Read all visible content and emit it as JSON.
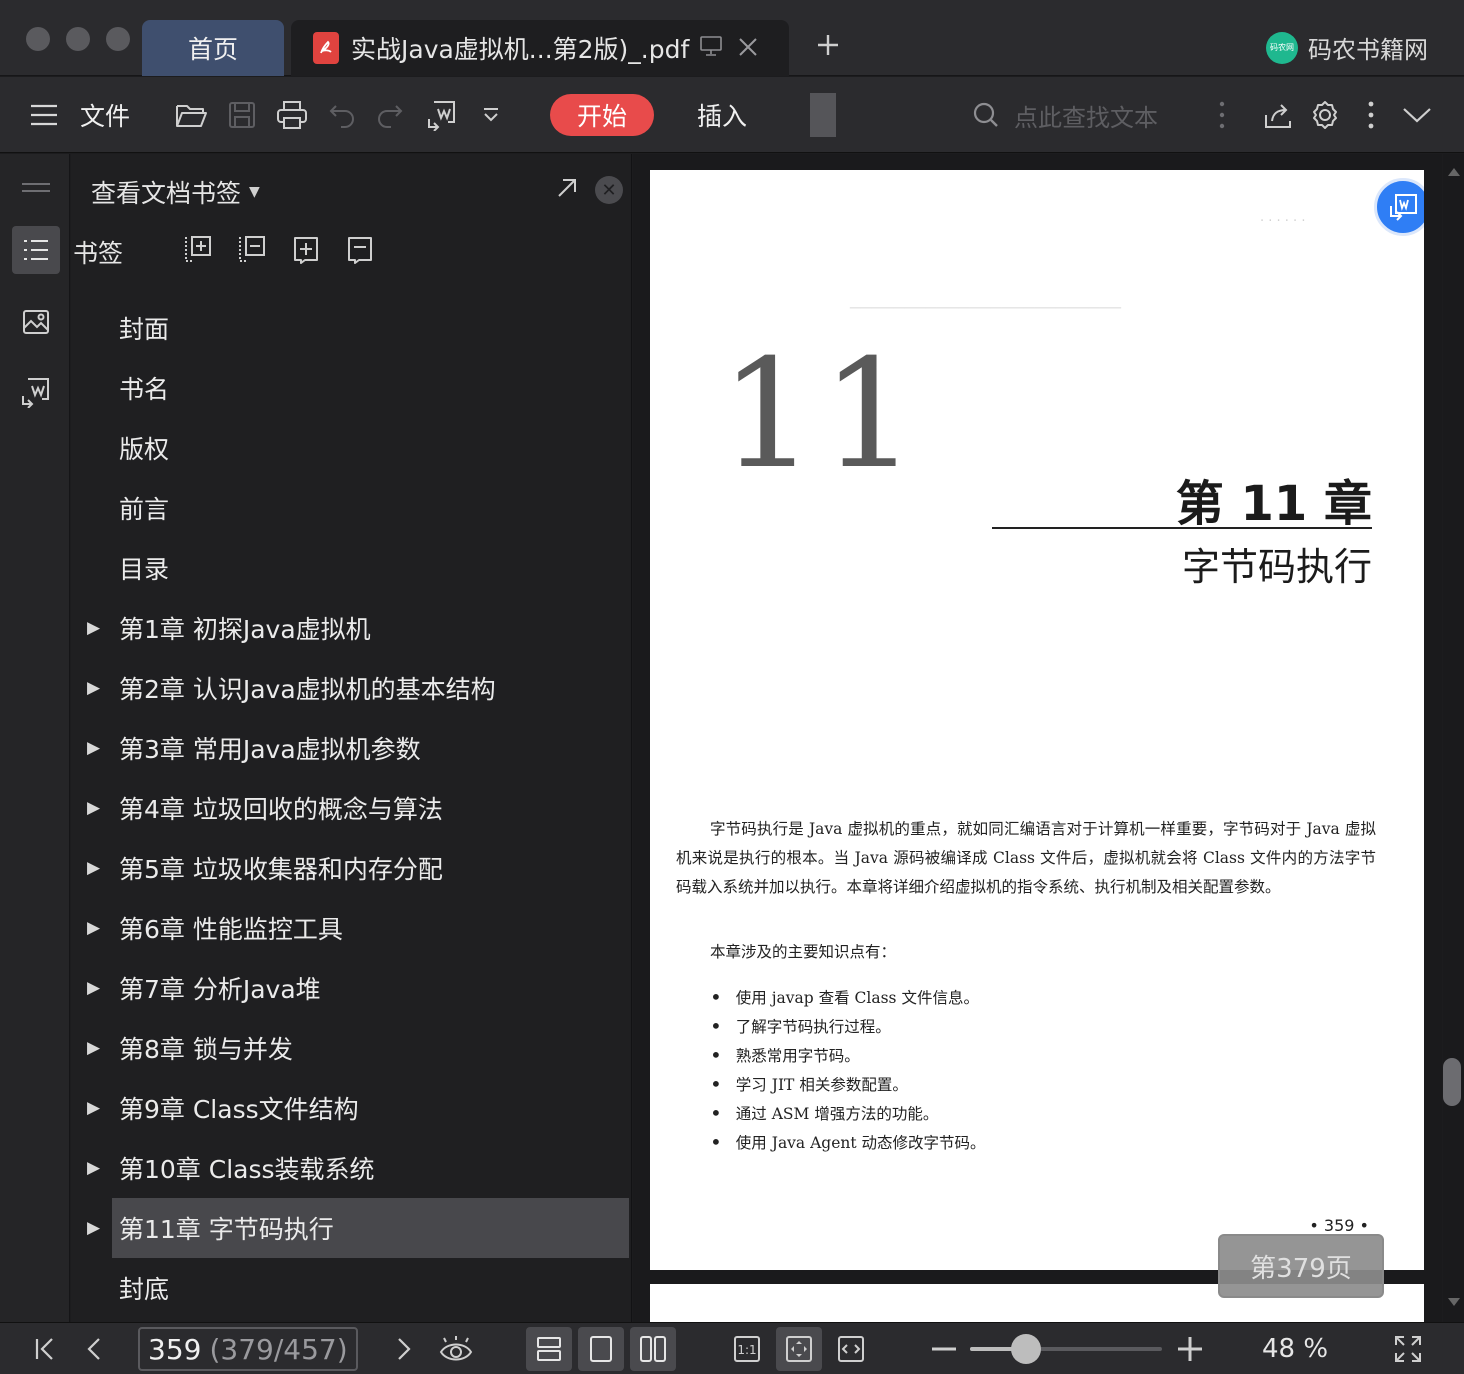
{
  "tabs": {
    "home": "首页",
    "doc": "实战Java虚拟机...第2版)_.pdf",
    "brand": "码农书籍网",
    "brand_logo_text": "码农网"
  },
  "toolbar": {
    "menu": "文件",
    "start": "开始",
    "insert": "插入",
    "search_placeholder": "点此查找文本"
  },
  "panel": {
    "title": "查看文档书签",
    "bookmarks_label": "书签",
    "items": [
      {
        "label": "封面",
        "expandable": false
      },
      {
        "label": "书名",
        "expandable": false
      },
      {
        "label": "版权",
        "expandable": false
      },
      {
        "label": "前言",
        "expandable": false
      },
      {
        "label": "目录",
        "expandable": false
      },
      {
        "label": "第1章  初探Java虚拟机",
        "expandable": true
      },
      {
        "label": "第2章  认识Java虚拟机的基本结构",
        "expandable": true
      },
      {
        "label": "第3章  常用Java虚拟机参数",
        "expandable": true
      },
      {
        "label": "第4章  垃圾回收的概念与算法",
        "expandable": true
      },
      {
        "label": "第5章  垃圾收集器和内存分配",
        "expandable": true
      },
      {
        "label": "第6章  性能监控工具",
        "expandable": true
      },
      {
        "label": "第7章  分析Java堆",
        "expandable": true
      },
      {
        "label": "第8章  锁与并发",
        "expandable": true
      },
      {
        "label": "第9章  Class文件结构",
        "expandable": true
      },
      {
        "label": "第10章  Class装载系统",
        "expandable": true
      },
      {
        "label": "第11章  字节码执行",
        "expandable": true,
        "selected": true
      },
      {
        "label": "封底",
        "expandable": false
      }
    ]
  },
  "page": {
    "big_number": "11",
    "chapter_number": "第 11 章",
    "chapter_title": "字节码执行",
    "intro": "字节码执行是 Java 虚拟机的重点，就如同汇编语言对于计算机一样重要，字节码对于 Java 虚拟机来说是执行的根本。当 Java 源码被编译成 Class 文件后，虚拟机就会将 Class 文件内的方法字节码载入系统并加以执行。本章将详细介绍虚拟机的指令系统、执行机制及相关配置参数。",
    "subheading": "本章涉及的主要知识点有：",
    "bullets": [
      "使用 javap 查看 Class 文件信息。",
      "了解字节码执行过程。",
      "熟悉常用字节码。",
      "学习 JIT 相关参数配置。",
      "通过 ASM 增强方法的功能。",
      "使用 Java Agent 动态修改字节码。"
    ],
    "page_number": "• 359 •",
    "page_tip": "第379页"
  },
  "status": {
    "page_current": "359",
    "page_detail": "(379/457)",
    "zoom_text": "48 %",
    "zoom_fraction": 0.29
  },
  "colors": {
    "accent_start": "#e84b4b",
    "float_button": "#2f7ef5",
    "brand_logo": "#1fb88f"
  }
}
